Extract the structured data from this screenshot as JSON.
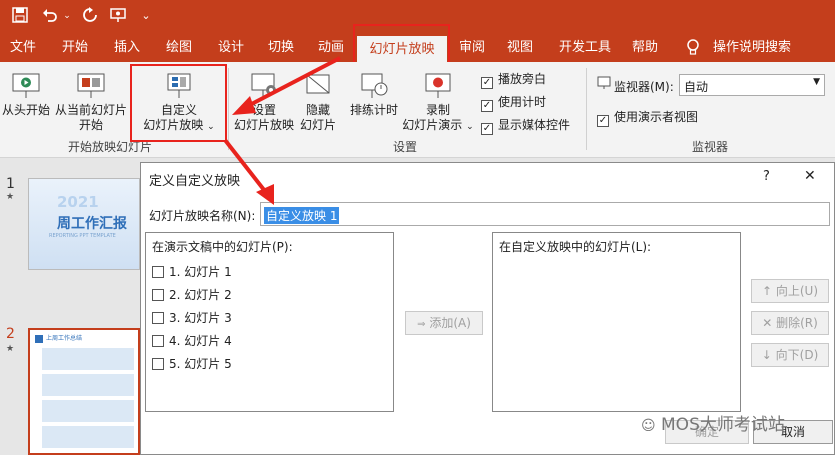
{
  "qat": {
    "save_icon": "save-icon",
    "undo_icon": "undo-icon",
    "redo_icon": "redo-icon",
    "present_icon": "present-from-beginning-icon",
    "customize_icon": "customize-qat-icon"
  },
  "tabs": [
    "文件",
    "开始",
    "插入",
    "绘图",
    "设计",
    "切换",
    "动画",
    "幻灯片放映",
    "审阅",
    "视图",
    "开发工具",
    "帮助"
  ],
  "tell_me": "操作说明搜索",
  "ribbon": {
    "from_beginning": "从头开始",
    "from_current_1": "从当前幻灯片",
    "from_current_2": "开始",
    "custom_show_1": "自定义",
    "custom_show_2": "幻灯片放映",
    "group_start": "开始放映幻灯片",
    "setup_1": "设置",
    "setup_2": "幻灯片放映",
    "hide_1": "隐藏",
    "hide_2": "幻灯片",
    "rehearse": "排练计时",
    "record_1": "录制",
    "record_2": "幻灯片演示",
    "group_setup": "设置",
    "chk_narration": "播放旁白",
    "chk_timing": "使用计时",
    "chk_media": "显示媒体控件",
    "monitor_label": "监视器(M):",
    "monitor_value": "自动",
    "chk_presenter": "使用演示者视图",
    "group_monitor": "监视器"
  },
  "slides": {
    "num1": "1",
    "num2": "2",
    "star": "★",
    "thumb1_year": "2021",
    "thumb1_title": "周工作汇报",
    "thumb1_sub": "REPORTING PPT TEMPLATE",
    "thumb2_title": "上周工作总结"
  },
  "dialog": {
    "title": "定义自定义放映",
    "help": "?",
    "close": "✕",
    "name_label": "幻灯片放映名称(N):",
    "name_value": "自定义放映 1",
    "left_header": "在演示文稿中的幻灯片(P):",
    "right_header": "在自定义放映中的幻灯片(L):",
    "slides": [
      "1. 幻灯片 1",
      "2. 幻灯片 2",
      "3. 幻灯片 3",
      "4. 幻灯片 4",
      "5. 幻灯片 5"
    ],
    "add": "添加(A)",
    "up": "向上(U)",
    "delete": "删除(R)",
    "down": "向下(D)",
    "ok": "确定",
    "cancel": "取消"
  },
  "watermark": "MOS大师考试站",
  "colors": {
    "accent": "#c43e1c",
    "highlight": "#e8231d"
  }
}
